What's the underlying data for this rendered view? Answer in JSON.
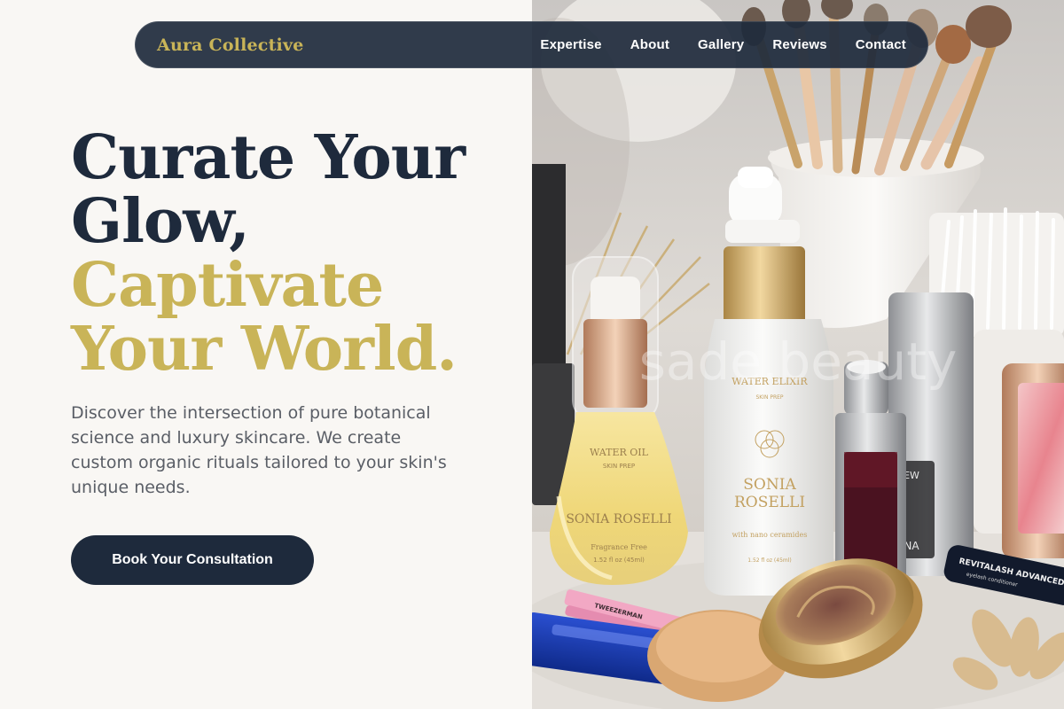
{
  "nav": {
    "brand": "Aura Collective",
    "links": [
      {
        "label": "Expertise"
      },
      {
        "label": "About"
      },
      {
        "label": "Gallery"
      },
      {
        "label": "Reviews"
      },
      {
        "label": "Contact"
      }
    ]
  },
  "hero": {
    "headline_line1": "Curate Your",
    "headline_line2": "Glow,",
    "headline_line3": "Captivate",
    "headline_line4": "Your World.",
    "description": "Discover the intersection of pure botanical science and luxury skincare. We create custom organic rituals tailored to your skin's unique needs.",
    "cta_label": "Book Your Consultation"
  },
  "image": {
    "watermark": "sade.beauty",
    "bottle_left": {
      "line1": "WATER OIL",
      "line2": "SKIN PREP",
      "line3": "SONIA ROSELLI",
      "line4": "Fragrance Free",
      "line5": "1.52 fl oz (45ml)"
    },
    "bottle_center": {
      "line1": "WATER ELIXIR",
      "line2": "SKIN PREP",
      "line3": "SONIA",
      "line4": "ROSELLI",
      "line5": "with nano ceramides",
      "line6": "1.52 fl oz (45ml)"
    },
    "tweezer_label": "TWEEZERMAN",
    "serum_label": "REVITALASH ADVANCED",
    "serum_sub": "eyelash conditioner",
    "silver_label_1": "EW",
    "silver_label_2": "NA"
  },
  "colors": {
    "navy": "#1e2a3c",
    "gold": "#c9b458",
    "background": "#f9f7f4",
    "body_text": "#5a5e66"
  }
}
